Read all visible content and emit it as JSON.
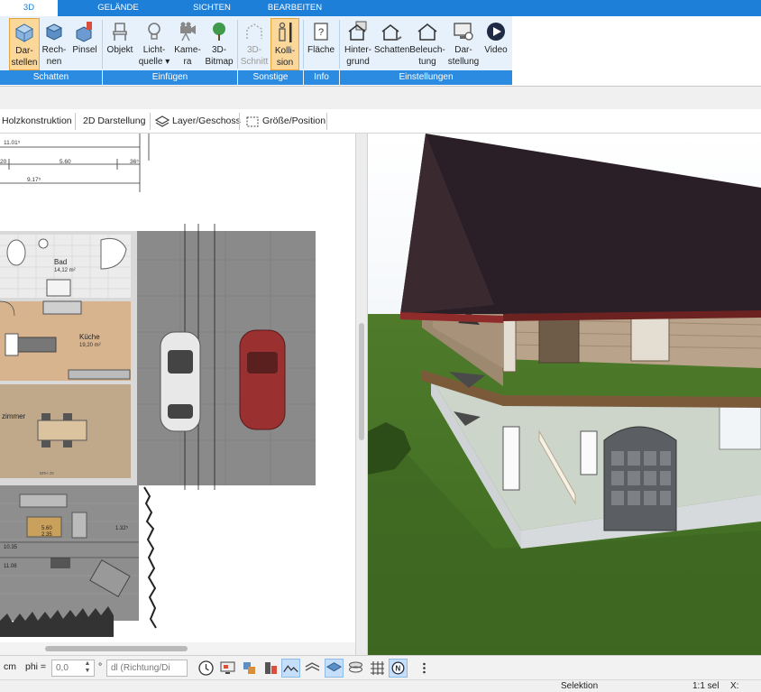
{
  "tabs": [
    {
      "label": "3D",
      "active": true
    },
    {
      "label": "GELÄNDE"
    },
    {
      "label": "SICHTEN"
    },
    {
      "label": "BEARBEITEN"
    }
  ],
  "ribbon": {
    "buttons": [
      {
        "line1": "Dar-",
        "line2": "stellen",
        "icon": "house-cube-icon",
        "active": true
      },
      {
        "line1": "Rech-",
        "line2": "nen",
        "icon": "cube-icon"
      },
      {
        "line1": "Pinsel",
        "line2": "",
        "icon": "paint-cube-icon"
      },
      {
        "line1": "Objekt",
        "line2": "",
        "icon": "chair-icon"
      },
      {
        "line1": "Licht-",
        "line2": "quelle ▾",
        "icon": "bulb-icon"
      },
      {
        "line1": "Kame-",
        "line2": "ra",
        "icon": "camera-icon"
      },
      {
        "line1": "3D-",
        "line2": "Bitmap",
        "icon": "tree-icon"
      },
      {
        "line1": "3D-",
        "line2": "Schnitt",
        "icon": "section-icon",
        "disabled": true
      },
      {
        "line1": "Kolli-",
        "line2": "sion",
        "icon": "person-icon",
        "active": true
      },
      {
        "line1": "Fläche",
        "line2": "",
        "icon": "area-icon"
      },
      {
        "line1": "Hinter-",
        "line2": "grund",
        "icon": "house-bg-icon"
      },
      {
        "line1": "Schatten",
        "line2": "",
        "icon": "house-shadow-icon"
      },
      {
        "line1": "Beleuch-",
        "line2": "tung",
        "icon": "house-light-icon"
      },
      {
        "line1": "Dar-",
        "line2": "stellung",
        "icon": "monitor-icon"
      },
      {
        "line1": "Video",
        "line2": "",
        "icon": "play-icon"
      }
    ],
    "groups": [
      "Schatten",
      "Einfügen",
      "Sonstige",
      "Info",
      "Einstellungen"
    ]
  },
  "toolbar2": {
    "items": [
      "Holzkonstruktion",
      "2D Darstellung",
      "Layer/Geschoss",
      "Größe/Position"
    ]
  },
  "plan": {
    "dims": [
      "11.01⁵",
      "20",
      "5.60",
      "36⁵",
      "9.17⁵",
      "1.32⁵",
      "10.35",
      "11.08",
      "2.35"
    ],
    "rooms": [
      {
        "name": "Bad",
        "area": "14,12 m²"
      },
      {
        "name": "Küche",
        "area": "19,20 m²"
      },
      {
        "name": "zimmer",
        "area": ""
      }
    ],
    "misc": [
      "5.60",
      "BRH 25"
    ]
  },
  "bottombar": {
    "unit": "cm",
    "phi_label": "phi =",
    "phi_value": "0,0",
    "degree": "°",
    "direction": "dl (Richtung/Di"
  },
  "status": {
    "mode": "Selektion",
    "scale": "1:1 sel",
    "x_label": "X:"
  }
}
